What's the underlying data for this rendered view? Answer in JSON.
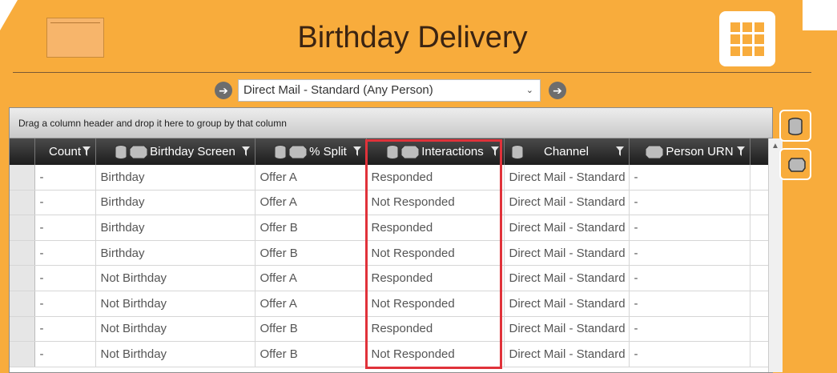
{
  "header": {
    "title": "Birthday Delivery"
  },
  "selector": {
    "value": "Direct Mail - Standard (Any Person)",
    "prev_icon": "arrow-left-icon",
    "next_icon": "arrow-right-icon"
  },
  "grid": {
    "group_hint": "Drag a column header and drop it here to group by that column",
    "columns": [
      {
        "label": "Count"
      },
      {
        "label": "Birthday Screen"
      },
      {
        "label": "% Split"
      },
      {
        "label": "Interactions"
      },
      {
        "label": "Channel"
      },
      {
        "label": "Person URN"
      }
    ],
    "rows": [
      {
        "count": "-",
        "screen": "Birthday",
        "split": "Offer A",
        "interactions": "Responded",
        "channel": "Direct Mail - Standard",
        "urn": "-"
      },
      {
        "count": "-",
        "screen": "Birthday",
        "split": "Offer A",
        "interactions": "Not Responded",
        "channel": "Direct Mail - Standard",
        "urn": "-"
      },
      {
        "count": "-",
        "screen": "Birthday",
        "split": "Offer B",
        "interactions": "Responded",
        "channel": "Direct Mail - Standard",
        "urn": "-"
      },
      {
        "count": "-",
        "screen": "Birthday",
        "split": "Offer B",
        "interactions": "Not Responded",
        "channel": "Direct Mail - Standard",
        "urn": "-"
      },
      {
        "count": "-",
        "screen": "Not Birthday",
        "split": "Offer A",
        "interactions": "Responded",
        "channel": "Direct Mail - Standard",
        "urn": "-"
      },
      {
        "count": "-",
        "screen": "Not Birthday",
        "split": "Offer A",
        "interactions": "Not Responded",
        "channel": "Direct Mail - Standard",
        "urn": "-"
      },
      {
        "count": "-",
        "screen": "Not Birthday",
        "split": "Offer B",
        "interactions": "Responded",
        "channel": "Direct Mail - Standard",
        "urn": "-"
      },
      {
        "count": "-",
        "screen": "Not Birthday",
        "split": "Offer B",
        "interactions": "Not Responded",
        "channel": "Direct Mail - Standard",
        "urn": "-"
      }
    ]
  },
  "colors": {
    "accent": "#f8ac3c",
    "highlight": "#e0323a"
  }
}
